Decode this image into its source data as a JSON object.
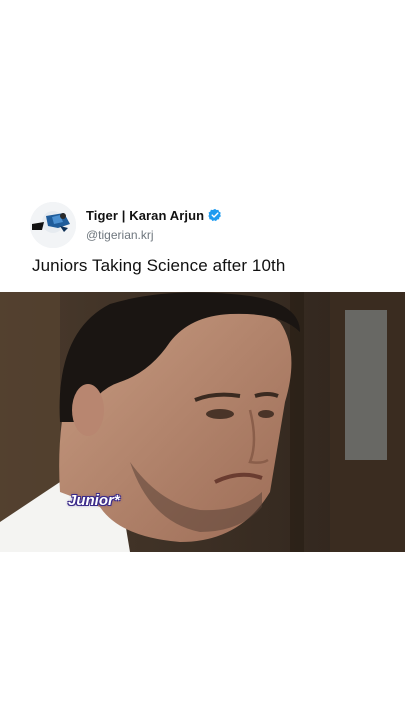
{
  "post": {
    "display_name": "Tiger | Karan Arjun",
    "handle": "@tigerian.krj",
    "caption": "Juniors Taking Science after 10th",
    "verified": true,
    "avatar_icon": "profile-avatar",
    "verified_icon": "verified-badge-icon"
  },
  "media": {
    "overlay_label": "Junior*"
  },
  "colors": {
    "verified": "#1d9bf0",
    "handle": "#6e767d",
    "overlay_outline": "#3a2a8a"
  }
}
